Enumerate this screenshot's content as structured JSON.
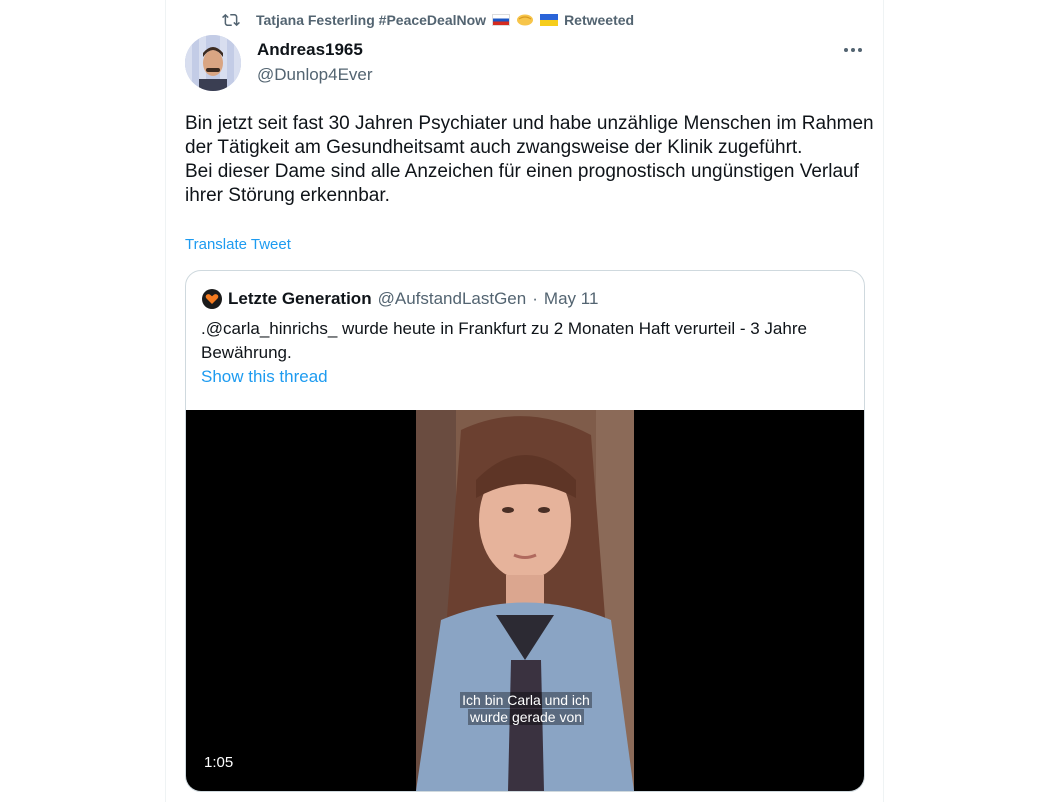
{
  "retweet": {
    "retweeter_name": "Tatjana Festerling #PeaceDealNow",
    "label": "Retweeted"
  },
  "author": {
    "name": "Andreas1965",
    "handle": "@Dunlop4Ever"
  },
  "tweet": {
    "text": "Bin jetzt seit fast 30 Jahren Psychiater und habe unzählige Menschen im Rahmen der Tätigkeit am Gesundheitsamt auch zwangsweise der Klinik zugeführt.\nBei dieser Dame sind alle Anzeichen für einen prognostisch ungünstigen Verlauf ihrer Störung erkennbar.",
    "translate_label": "Translate Tweet"
  },
  "quote": {
    "name": "Letzte Generation",
    "handle": "@AufstandLastGen",
    "separator": "·",
    "date": "May 11",
    "text": ".@carla_hinrichs_ wurde heute in Frankfurt zu 2 Monaten Haft verurteil - 3 Jahre Bewährung.",
    "thread_label": "Show this thread",
    "video": {
      "subtitle_line1": "Ich bin Carla und ich",
      "subtitle_line2": "wurde gerade von",
      "duration": "1:05"
    }
  },
  "colors": {
    "link": "#1d9bf0",
    "secondary_text": "#536471",
    "border": "#cfd9de"
  },
  "icons": {
    "retweet": "retweet-icon",
    "more": "more-icon",
    "quote_logo": "heart-logo-icon"
  }
}
